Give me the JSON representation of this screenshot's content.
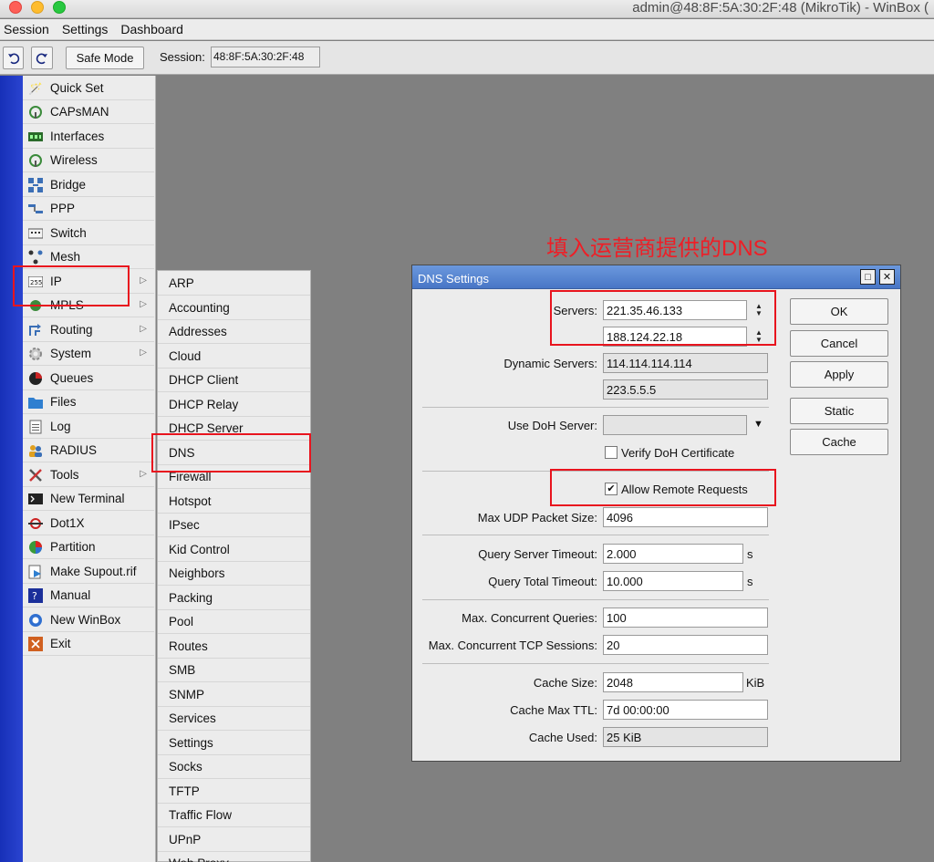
{
  "window": {
    "title": "admin@48:8F:5A:30:2F:48 (MikroTik) - WinBox ("
  },
  "menubar": {
    "items": [
      "Session",
      "Settings",
      "Dashboard"
    ]
  },
  "toolbar": {
    "undo_icon": "undo-icon",
    "redo_icon": "redo-icon",
    "safe_mode": "Safe Mode",
    "session_label": "Session:",
    "session_value": "48:8F:5A:30:2F:48"
  },
  "main_menu": {
    "items": [
      {
        "label": "Quick Set",
        "icon": "wand-icon",
        "submenu": false
      },
      {
        "label": "CAPsMAN",
        "icon": "antenna-icon",
        "submenu": false
      },
      {
        "label": "Interfaces",
        "icon": "interfaces-icon",
        "submenu": false
      },
      {
        "label": "Wireless",
        "icon": "wireless-icon",
        "submenu": false
      },
      {
        "label": "Bridge",
        "icon": "bridge-icon",
        "submenu": false
      },
      {
        "label": "PPP",
        "icon": "ppp-icon",
        "submenu": false
      },
      {
        "label": "Switch",
        "icon": "switch-icon",
        "submenu": false
      },
      {
        "label": "Mesh",
        "icon": "mesh-icon",
        "submenu": false
      },
      {
        "label": "IP",
        "icon": "ip-icon",
        "submenu": true
      },
      {
        "label": "MPLS",
        "icon": "mpls-icon",
        "submenu": true
      },
      {
        "label": "Routing",
        "icon": "routing-icon",
        "submenu": true
      },
      {
        "label": "System",
        "icon": "gear-icon",
        "submenu": true
      },
      {
        "label": "Queues",
        "icon": "queues-icon",
        "submenu": false
      },
      {
        "label": "Files",
        "icon": "folder-icon",
        "submenu": false
      },
      {
        "label": "Log",
        "icon": "log-icon",
        "submenu": false
      },
      {
        "label": "RADIUS",
        "icon": "users-icon",
        "submenu": false
      },
      {
        "label": "Tools",
        "icon": "tools-icon",
        "submenu": true
      },
      {
        "label": "New Terminal",
        "icon": "terminal-icon",
        "submenu": false
      },
      {
        "label": "Dot1X",
        "icon": "dot1x-icon",
        "submenu": false
      },
      {
        "label": "Partition",
        "icon": "pie-icon",
        "submenu": false
      },
      {
        "label": "Make Supout.rif",
        "icon": "supout-icon",
        "submenu": false
      },
      {
        "label": "Manual",
        "icon": "manual-icon",
        "submenu": false
      },
      {
        "label": "New WinBox",
        "icon": "winbox-icon",
        "submenu": false
      },
      {
        "label": "Exit",
        "icon": "exit-icon",
        "submenu": false
      }
    ]
  },
  "ip_submenu": {
    "items": [
      "ARP",
      "Accounting",
      "Addresses",
      "Cloud",
      "DHCP Client",
      "DHCP Relay",
      "DHCP Server",
      "DNS",
      "Firewall",
      "Hotspot",
      "IPsec",
      "Kid Control",
      "Neighbors",
      "Packing",
      "Pool",
      "Routes",
      "SMB",
      "SNMP",
      "Services",
      "Settings",
      "Socks",
      "TFTP",
      "Traffic Flow",
      "UPnP",
      "Web Proxy"
    ]
  },
  "annotation": {
    "text": "填入运营商提供的DNS",
    "color": "#ee1e26"
  },
  "dns": {
    "title": "DNS Settings",
    "servers_label": "Servers:",
    "servers": [
      "221.35.46.133",
      "188.124.22.18"
    ],
    "dynamic_servers_label": "Dynamic Servers:",
    "dynamic_servers": [
      "114.114.114.114",
      "223.5.5.5"
    ],
    "use_doh_label": "Use DoH Server:",
    "use_doh_value": "",
    "verify_doh_label": "Verify DoH Certificate",
    "verify_doh_checked": false,
    "allow_remote_label": "Allow Remote Requests",
    "allow_remote_checked": true,
    "max_udp_label": "Max UDP Packet Size:",
    "max_udp_value": "4096",
    "query_server_timeout_label": "Query Server Timeout:",
    "query_server_timeout_value": "2.000",
    "query_total_timeout_label": "Query Total Timeout:",
    "query_total_timeout_value": "10.000",
    "seconds_unit": "s",
    "max_queries_label": "Max. Concurrent Queries:",
    "max_queries_value": "100",
    "max_tcp_label": "Max. Concurrent TCP Sessions:",
    "max_tcp_value": "20",
    "cache_size_label": "Cache Size:",
    "cache_size_value": "2048",
    "cache_size_unit": "KiB",
    "cache_ttl_label": "Cache Max TTL:",
    "cache_ttl_value": "7d 00:00:00",
    "cache_used_label": "Cache Used:",
    "cache_used_value": "25 KiB",
    "buttons": {
      "ok": "OK",
      "cancel": "Cancel",
      "apply": "Apply",
      "static": "Static",
      "cache": "Cache"
    }
  },
  "colors": {
    "accent_blue": "#4876c6",
    "sidebar_blue": "#1730b8",
    "highlight_red": "#e8141e"
  }
}
